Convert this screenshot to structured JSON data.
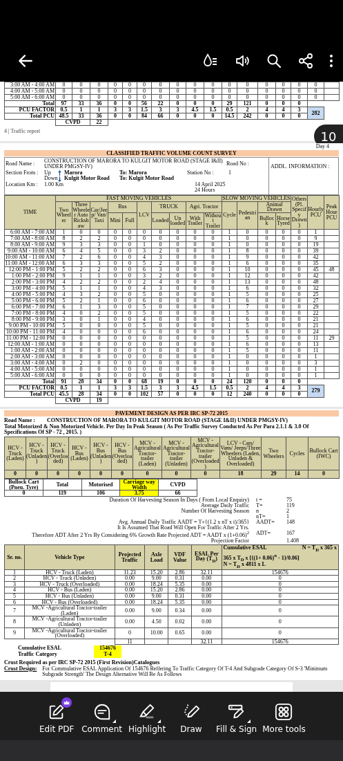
{
  "page_badge": "10",
  "page_top": {
    "rows": [
      {
        "label": "3:00 AM - 4:00 AM",
        "values": [
          "0",
          "0",
          "0",
          "0",
          "0",
          "0",
          "0",
          "0",
          "0",
          "0",
          "0",
          "0",
          "0",
          "0",
          "0",
          "0"
        ]
      },
      {
        "label": "4:00 AM - 5:00 AM",
        "values": [
          "0",
          "0",
          "0",
          "0",
          "0",
          "0",
          "0",
          "0",
          "0",
          "0",
          "0",
          "0",
          "0",
          "0",
          "0",
          "0"
        ]
      },
      {
        "label": "5:00 AM - 6:00 AM",
        "values": [
          "0",
          "0",
          "0",
          "0",
          "0",
          "0",
          "0",
          "0",
          "0",
          "0",
          "0",
          "0",
          "0",
          "0",
          "0",
          "0"
        ]
      }
    ],
    "total": {
      "label": "Total",
      "values": [
        "97",
        "33",
        "36",
        "0",
        "0",
        "56",
        "22",
        "0",
        "0",
        "0",
        "29",
        "121",
        "0",
        "0",
        "0"
      ]
    },
    "pcu_factor": {
      "label": "PCU FACTOR",
      "values": [
        "0.5",
        "1",
        "1",
        "3",
        "3",
        "1.5",
        "3",
        "3",
        "4.5",
        "1.5",
        "0.5",
        "2",
        "4",
        "4",
        "3"
      ]
    },
    "total_pcu": {
      "label": "Total PCU",
      "values": [
        "48.5",
        "33",
        "36",
        "0",
        "0",
        "84",
        "66",
        "0",
        "0",
        "0",
        "14.5",
        "242",
        "0",
        "0",
        "0"
      ]
    },
    "pcu_sum": "282",
    "cvpd_label": "CVPD",
    "cvpd": "22",
    "footer": "4 | Traffic report"
  },
  "survey": {
    "day": "Day 4",
    "title": "CLASSIFIED TRAFFIC VOLUME COUNT SURVEY",
    "info": {
      "road_name_label": "Road Name :",
      "road_name": "CONSTRUCTION OF MARORA TO KULGIT MOTOR ROAD (STAGE I&II) UNDER PMGSY-IV)",
      "road_no_label": "Road No :",
      "section_label": "Section From :",
      "up": "Up",
      "up_from": "Marora",
      "up_to": "To: Marora",
      "station_label": "Station No :",
      "station": "1",
      "down": "Down",
      "down_from": "Kulgit Motor Road",
      "down_to": "To: Kulgit Motor Road",
      "location_label": "Location Km :",
      "location": "1.00 Km",
      "date": "14 April 2025",
      "duration": "24 Hours",
      "addl": "ADDL. INFORMATION :"
    },
    "header_rows": [
      [
        {
          "text": "TIME",
          "rowspan": 3
        },
        {
          "text": "FAST MOVING VEHICLES",
          "colspan": 10
        },
        {
          "text": "SLOW MOVING VEHICLES",
          "colspan": 4
        },
        {
          "text": "Others (Pl. Specify Drawn)",
          "rowspan": 3
        },
        {
          "text": "Hourly PCU",
          "rowspan": 3
        },
        {
          "text": "Peak Hour PCU",
          "rowspan": 3
        }
      ],
      [
        {
          "text": "Two Wheeler",
          "rowspan": 2
        },
        {
          "text": "Three Wheeler Auto Rickshaw",
          "rowspan": 2
        },
        {
          "text": "Car/Jeep/ Van/ Taxi",
          "rowspan": 2
        },
        {
          "text": "Bus",
          "colspan": 2
        },
        {
          "text": "LCV",
          "rowspan": 2
        },
        {
          "text": "TRUCK",
          "colspan": 2
        },
        {
          "text": "Agri. Tractor",
          "colspan": 2
        },
        {
          "text": "Cycle",
          "rowspan": 2
        },
        {
          "text": "Pedestrian",
          "rowspan": 2
        },
        {
          "text": "Animal Drawn",
          "colspan": 2
        }
      ],
      [
        {
          "text": "Mini"
        },
        {
          "text": "Full"
        },
        {
          "text": "Loaded"
        },
        {
          "text": "Un loaded"
        },
        {
          "text": "With Trailer"
        },
        {
          "text": "Without Trailer"
        },
        {
          "text": "Bullock"
        },
        {
          "text": "Horse Tyred"
        }
      ]
    ],
    "rows": [
      {
        "label": "6:00 AM - 7:00 AM",
        "values": [
          "1",
          "0",
          "0",
          "0",
          "0",
          "0",
          "0",
          "0",
          "0",
          "0",
          "1",
          "0",
          "0",
          "0",
          "0",
          "1"
        ]
      },
      {
        "label": "7:00 AM - 8:00 AM",
        "values": [
          "8",
          "2",
          "2",
          "0",
          "0",
          "0",
          "0",
          "0",
          "0",
          "0",
          "1",
          "0",
          "0",
          "0",
          "0",
          "9"
        ]
      },
      {
        "label": "8:00 AM - 9:00 AM",
        "values": [
          "9",
          "3",
          "3",
          "0",
          "0",
          "1",
          "0",
          "0",
          "0",
          "0",
          "1",
          "0",
          "0",
          "0",
          "0",
          "19"
        ]
      },
      {
        "label": "9:00 AM - 10:00 AM",
        "values": [
          "6",
          "4",
          "5",
          "0",
          "0",
          "3",
          "2",
          "0",
          "0",
          "0",
          "1",
          "8",
          "0",
          "0",
          "0",
          "39"
        ]
      },
      {
        "label": "10:00 AM - 11:00 AM",
        "values": [
          "7",
          "2",
          "6",
          "0",
          "0",
          "4",
          "3",
          "0",
          "0",
          "0",
          "1",
          "9",
          "0",
          "0",
          "0",
          "42"
        ]
      },
      {
        "label": "11:00 AM - 12:00 AM",
        "values": [
          "6",
          "3",
          "3",
          "0",
          "0",
          "5",
          "2",
          "0",
          "0",
          "0",
          "1",
          "6",
          "0",
          "0",
          "0",
          "35"
        ]
      },
      {
        "label": "12:00 PM - 1:00 PM",
        "values": [
          "5",
          "2",
          "2",
          "0",
          "0",
          "6",
          "3",
          "0",
          "0",
          "0",
          "1",
          "10",
          "0",
          "0",
          "0",
          "45"
        ],
        "peak": "48"
      },
      {
        "label": "1:00 PM - 2:00 PM",
        "values": [
          "9",
          "1",
          "1",
          "0",
          "0",
          "3",
          "2",
          "0",
          "0",
          "0",
          "1",
          "12",
          "0",
          "0",
          "0",
          "42"
        ]
      },
      {
        "label": "2:00 PM - 3:00 PM",
        "values": [
          "4",
          "2",
          "2",
          "0",
          "0",
          "2",
          "4",
          "0",
          "0",
          "0",
          "1",
          "13",
          "0",
          "0",
          "0",
          "48"
        ]
      },
      {
        "label": "3:00 PM - 4:00 PM",
        "values": [
          "5",
          "1",
          "1",
          "0",
          "0",
          "4",
          "3",
          "0",
          "0",
          "0",
          "1",
          "6",
          "0",
          "0",
          "0",
          "32"
        ]
      },
      {
        "label": "4:00 PM - 5:00 PM",
        "values": [
          "4",
          "3",
          "2",
          "0",
          "0",
          "5",
          "0",
          "0",
          "0",
          "0",
          "1",
          "5",
          "0",
          "0",
          "0",
          "25"
        ]
      },
      {
        "label": "5:00 PM - 6:00 PM",
        "values": [
          "5",
          "2",
          "1",
          "0",
          "0",
          "6",
          "0",
          "0",
          "0",
          "0",
          "1",
          "6",
          "0",
          "0",
          "0",
          "27"
        ]
      },
      {
        "label": "6:00 PM - 7:00 PM",
        "values": [
          "6",
          "1",
          "3",
          "0",
          "0",
          "5",
          "0",
          "0",
          "0",
          "0",
          "1",
          "7",
          "0",
          "0",
          "0",
          "29"
        ]
      },
      {
        "label": "7:00 PM - 8:00 PM",
        "values": [
          "4",
          "0",
          "2",
          "0",
          "0",
          "5",
          "0",
          "0",
          "0",
          "0",
          "1",
          "5",
          "0",
          "0",
          "0",
          "22"
        ]
      },
      {
        "label": "8:00 PM - 9:00 PM",
        "values": [
          "3",
          "0",
          "1",
          "0",
          "0",
          "4",
          "0",
          "0",
          "0",
          "0",
          "1",
          "6",
          "0",
          "0",
          "0",
          "21"
        ]
      },
      {
        "label": "9:00 PM - 10:00 PM",
        "values": [
          "5",
          "0",
          "0",
          "0",
          "0",
          "5",
          "0",
          "0",
          "0",
          "0",
          "1",
          "5",
          "0",
          "0",
          "0",
          "21"
        ]
      },
      {
        "label": "10:00 PM - 11:00 PM",
        "values": [
          "4",
          "0",
          "0",
          "0",
          "0",
          "6",
          "0",
          "0",
          "0",
          "0",
          "1",
          "6",
          "0",
          "0",
          "0",
          "24"
        ]
      },
      {
        "label": "11:00 PM - 12:00 PM",
        "values": [
          "0",
          "0",
          "0",
          "0",
          "0",
          "0",
          "0",
          "0",
          "0",
          "0",
          "1",
          "5",
          "0",
          "0",
          "0",
          "11"
        ],
        "peak": "29"
      },
      {
        "label": "12:00 AM - 1:00 AM",
        "values": [
          "0",
          "0",
          "0",
          "0",
          "0",
          "0",
          "0",
          "0",
          "0",
          "0",
          "1",
          "6",
          "0",
          "0",
          "0",
          "13"
        ]
      },
      {
        "label": "1:00 AM - 2:00 AM",
        "values": [
          "0",
          "0",
          "0",
          "0",
          "0",
          "0",
          "0",
          "0",
          "0",
          "0",
          "1",
          "5",
          "0",
          "0",
          "0",
          "11"
        ]
      },
      {
        "label": "2:00 AM - 3:00 AM",
        "values": [
          "0",
          "0",
          "0",
          "0",
          "0",
          "0",
          "0",
          "0",
          "0",
          "0",
          "1",
          "0",
          "0",
          "0",
          "0",
          "1"
        ]
      },
      {
        "label": "3:00 AM - 4:00 AM",
        "values": [
          "0",
          "2",
          "0",
          "0",
          "0",
          "0",
          "0",
          "0",
          "0",
          "0",
          "1",
          "0",
          "0",
          "0",
          "0",
          "3"
        ]
      },
      {
        "label": "4:00 AM - 5:00 AM",
        "values": [
          "0",
          "0",
          "0",
          "0",
          "0",
          "0",
          "0",
          "0",
          "0",
          "0",
          "1",
          "0",
          "0",
          "0",
          "0",
          "1"
        ]
      },
      {
        "label": "5:00 AM - 6:00 AM",
        "values": [
          "0",
          "0",
          "0",
          "0",
          "0",
          "0",
          "0",
          "0",
          "0",
          "0",
          "1",
          "0",
          "0",
          "0",
          "0",
          "1"
        ]
      }
    ],
    "total": {
      "label": "Total",
      "values": [
        "91",
        "28",
        "34",
        "0",
        "0",
        "68",
        "19",
        "0",
        "0",
        "0",
        "24",
        "120",
        "0",
        "0",
        "0"
      ]
    },
    "pcu_factor": {
      "label": "PCU FACTOR",
      "values": [
        "0.5",
        "1",
        "1",
        "3",
        "3",
        "1.5",
        "3",
        "3",
        "4.5",
        "1.5",
        "0.5",
        "2",
        "4",
        "4",
        "3"
      ]
    },
    "total_pcu": {
      "label": "Total PCU",
      "values": [
        "45.5",
        "28",
        "34",
        "0",
        "0",
        "102",
        "57",
        "0",
        "0",
        "0",
        "12",
        "240",
        "0",
        "0",
        "0"
      ]
    },
    "pcu_sum": "279",
    "cvpd_label": "CVPD",
    "cvpd": "19"
  },
  "pavement": {
    "title": "PAVEMENT DESIGN AS PER IRC SP-72 2015",
    "road_name_label": "Road Name :",
    "road_name": "CONSTRUCTION OF MARORA TO KULGIT MOTOR ROAD (STAGE I&II) UNDER PMGSY-IV)",
    "intro": "Total Motorized & Non Motorized Vehicle. Per Day In Peak Season ( As Per Traffic Survey Conducted As Per Para 2.1.1 & 3.0 Of Specifications Of SP - 72 , 2015. )",
    "vehicle_columns": [
      "HCV - Truck (Laden)",
      "HCV - Truck (Unladen)",
      "HCV - Truck (Overloaded)",
      "HCV - Bus (Laden)",
      "HCV - Bus (Unladen)",
      "HCV - Bus (Overloaded)",
      "MCV - Agricultural Tractor-trailer (Laden)",
      "MCV - Agricultural Tractor-trailer (Unladen)",
      "MCV - Agricultural Tractor-trailer (Overloaded)",
      "LCV - Cars/ Vans/ Jeeps/Three Wheelers (Laden, Unladen & Overloaded)",
      "Two Wheelers",
      "Cycles",
      "Bullock Cart (IWC)"
    ],
    "vehicle_values": [
      "0",
      "0",
      "0",
      "0",
      "0",
      "0",
      "0",
      "0",
      "0",
      "18",
      "29",
      "14",
      "0"
    ],
    "summary": [
      {
        "label": "Bullock Cart (Pneu. Tyre)",
        "value": "0",
        "highlighted": false
      },
      {
        "label": "Total",
        "value": "119",
        "highlighted": false
      },
      {
        "label": "Motorised",
        "value": "106",
        "highlighted": false
      },
      {
        "label": "Carriage way Width",
        "value": "3.75",
        "highlighted": true
      },
      {
        "label": "CVPD",
        "value": "66",
        "highlighted": false
      }
    ],
    "calc": [
      {
        "text": "Duration Of Harvesting Season In Days ( From Local Enquiry)",
        "symbol": "t =",
        "value": "75"
      },
      {
        "text": "Average Daily Traffic",
        "symbol": "T=",
        "value": "119"
      },
      {
        "text": "Number Of Harvesting Season",
        "symbol": "n",
        "value": "2"
      },
      {
        "symbol": "nT=",
        "value": "1"
      },
      {
        "text": "Avg. Annual Daily Traffic  AADT = T+{(1.2 x nT x t)/365}",
        "symbol": "AADT=",
        "value": "148"
      },
      {
        "text": "It Is Assumed That Road Will Open For Traffic After 2 Yrs."
      },
      {
        "text": "Therefore ADT After 2 Yrs By Considering 6% Growth Rate Projected  ADT = AADT x (1+0.06)$^{2}$",
        "symbol": "ADT=",
        "value": "167"
      },
      {
        "text": "Projection Factor",
        "value": "1.408"
      }
    ],
    "esal_columns": [
      "Sr. no.",
      "Vehicle Type",
      "Projected Traffic",
      "Axle Load",
      "VDF Value",
      "ESAL Per Day (T$_{D}$)"
    ],
    "esal_formula": {
      "label": "Cumulative ESAL",
      "formula": "365 x T$_{D}$ x [{(1+ 0.06)$^{n}$ - 1}/0.06]",
      "n1": "N = T$_{D}$ x 365 x",
      "n2": "N = T$_{D}$ x 4811 x L"
    },
    "esal_rows": [
      {
        "sr": "1",
        "type": "HCV - Truck (Laden)",
        "traffic": "11.23",
        "axle": "15.20",
        "vdf": "2.86",
        "esal": "32.11",
        "cumulative": "154676"
      },
      {
        "sr": "2",
        "type": "HCV - Truck (Unladen)",
        "traffic": "0.00",
        "axle": "9.00",
        "vdf": "0.31",
        "esal": "0.00",
        "cumulative": "0"
      },
      {
        "sr": "3",
        "type": "HCV - Truck (Overloaded)",
        "traffic": "0.00",
        "axle": "18.24",
        "vdf": "5.35",
        "esal": "0.00",
        "cumulative": "0"
      },
      {
        "sr": "4",
        "type": "HCV - Bus (Laden)",
        "traffic": "0.00",
        "axle": "15.20",
        "vdf": "2.86",
        "esal": "0.00",
        "cumulative": "0"
      },
      {
        "sr": "5",
        "type": "HCV - Bus (Unladen)",
        "traffic": "0.00",
        "axle": "9.00",
        "vdf": "0.31",
        "esal": "0.00",
        "cumulative": "0"
      },
      {
        "sr": "6",
        "type": "HCV - Bus (Overloaded)",
        "traffic": "0.00",
        "axle": "18.24",
        "vdf": "5.35",
        "esal": "0.00",
        "cumulative": "0"
      },
      {
        "sr": "7",
        "type": "MCV -Agricultural Tractor-trailer (Laden)",
        "traffic": "0.00",
        "axle": "9.00",
        "vdf": "0.34",
        "esal": "0.00",
        "cumulative": "0"
      },
      {
        "sr": "8",
        "type": "MCV -Agricultural Tractor-trailer (Unladen)",
        "traffic": "0.00",
        "axle": "4.50",
        "vdf": "0.02",
        "esal": "0.00",
        "cumulative": "0"
      },
      {
        "sr": "9",
        "type": "MCV -Agricultural Tractor-trailer (Overloaded)",
        "traffic": "0",
        "axle": "10.00",
        "vdf": "0.65",
        "esal": "0.00",
        "cumulative": "0"
      }
    ],
    "esal_total": {
      "traffic": "11",
      "esal": "32.11",
      "cumulative": "154676"
    },
    "results": [
      {
        "label": "Cumulative ESAL",
        "value": "154676"
      },
      {
        "label": "Traffic Category",
        "value": "T-4"
      }
    ],
    "crust_heading": "Crust Required as per IRC SP-72 2015 (First Revision)Catalogues",
    "crust_label": "Crust Design:",
    "crust_text": "For Commulative ESAL Application Of 154676 Reffering To Traffic Category Of T-4  And Subgrade Category Of S-3  'Minimum Subgrade Strength' The Design Alternative Will Be As Follows"
  },
  "toolbar": [
    {
      "label": "Edit PDF",
      "kind": "edit",
      "premium": true,
      "submenu": false
    },
    {
      "label": "Comment",
      "kind": "comment",
      "premium": false,
      "submenu": true
    },
    {
      "label": "Highlight",
      "kind": "highlight",
      "premium": false,
      "submenu": true
    },
    {
      "label": "Draw",
      "kind": "draw",
      "premium": false,
      "submenu": false
    },
    {
      "label": "Fill & Sign",
      "kind": "sign",
      "premium": false,
      "submenu": true
    },
    {
      "label": "More tools",
      "kind": "more",
      "premium": false,
      "submenu": false
    }
  ]
}
